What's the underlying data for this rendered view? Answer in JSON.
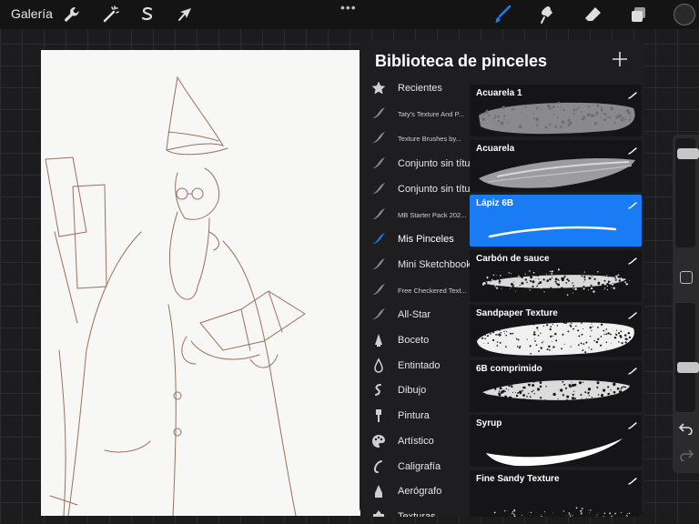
{
  "toolbar": {
    "gallery_label": "Galería",
    "menu_dots": "•••",
    "active_color": "#1a7cf5",
    "icons": [
      "wrench-icon",
      "magic-wand-icon",
      "selection-s-icon",
      "arrow-cursor-icon",
      "brush-icon",
      "smudge-icon",
      "eraser-icon",
      "layers-icon"
    ]
  },
  "panel": {
    "title": "Biblioteca de pinceles",
    "add_icon": "plus-icon",
    "sets": [
      {
        "label": "Recientes",
        "icon": "star-icon",
        "small": false
      },
      {
        "label": "Taty's Texture And P...",
        "icon": "stroke-icon",
        "small": true
      },
      {
        "label": "Texture Brushes by...",
        "icon": "stroke-icon",
        "small": true
      },
      {
        "label": "Conjunto sin título",
        "icon": "stroke-icon",
        "small": false
      },
      {
        "label": "Conjunto sin título",
        "icon": "stroke-icon",
        "small": false
      },
      {
        "label": "MB Starter Pack 202...",
        "icon": "stroke-icon",
        "small": true
      },
      {
        "label": "Mis Pinceles",
        "icon": "stroke-icon-active",
        "small": false
      },
      {
        "label": "Mini Sketchbook",
        "icon": "stroke-icon",
        "small": false
      },
      {
        "label": "Free Checkered Text...",
        "icon": "stroke-icon",
        "small": true
      },
      {
        "label": "All-Star",
        "icon": "stroke-icon",
        "small": false
      },
      {
        "label": "Boceto",
        "icon": "pencil-tip-icon",
        "small": false
      },
      {
        "label": "Entintado",
        "icon": "ink-drop-icon",
        "small": false
      },
      {
        "label": "Dibujo",
        "icon": "squiggle-icon",
        "small": false
      },
      {
        "label": "Pintura",
        "icon": "paintbrush-icon",
        "small": false
      },
      {
        "label": "Artístico",
        "icon": "palette-icon",
        "small": false
      },
      {
        "label": "Caligrafía",
        "icon": "calligraphy-icon",
        "small": false
      },
      {
        "label": "Aerógrafo",
        "icon": "airbrush-icon",
        "small": false
      },
      {
        "label": "Texturas",
        "icon": "texture-icon",
        "small": false
      }
    ],
    "brushes": [
      {
        "name": "Acuarela 1",
        "style": "watercolor1",
        "selected": false
      },
      {
        "name": "Acuarela",
        "style": "watercolor",
        "selected": false
      },
      {
        "name": "Lápiz 6B",
        "style": "pencil",
        "selected": true
      },
      {
        "name": "Carbón de sauce",
        "style": "charcoal",
        "selected": false
      },
      {
        "name": "Sandpaper Texture",
        "style": "sandpaper",
        "selected": false
      },
      {
        "name": "6B comprimido",
        "style": "compressed",
        "selected": false
      },
      {
        "name": "Syrup",
        "style": "syrup",
        "selected": false
      },
      {
        "name": "Fine Sandy Texture",
        "style": "sandy",
        "selected": false
      }
    ]
  },
  "sidebar": {
    "size_level": 0.1,
    "opacity_level": 0.6
  }
}
